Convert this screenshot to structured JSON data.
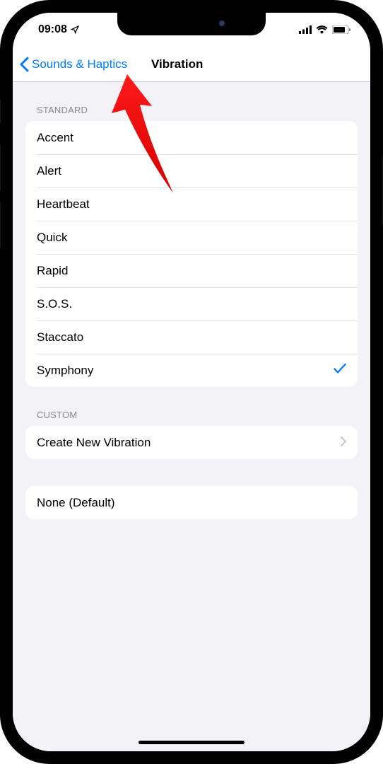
{
  "status_bar": {
    "time": "09:08"
  },
  "nav": {
    "back_label": "Sounds & Haptics",
    "title": "Vibration"
  },
  "sections": {
    "standard": {
      "header": "Standard",
      "items": [
        {
          "label": "Accent",
          "selected": false
        },
        {
          "label": "Alert",
          "selected": false
        },
        {
          "label": "Heartbeat",
          "selected": false
        },
        {
          "label": "Quick",
          "selected": false
        },
        {
          "label": "Rapid",
          "selected": false
        },
        {
          "label": "S.O.S.",
          "selected": false
        },
        {
          "label": "Staccato",
          "selected": false
        },
        {
          "label": "Symphony",
          "selected": true
        }
      ]
    },
    "custom": {
      "header": "Custom",
      "create_label": "Create New Vibration"
    },
    "none": {
      "label": "None (Default)"
    }
  }
}
